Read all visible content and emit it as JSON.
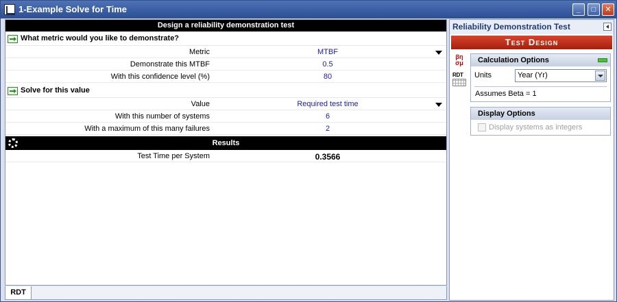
{
  "window": {
    "title": "1-Example Solve for Time",
    "minimize_label": "_",
    "maximize_label": "□",
    "close_label": "✕"
  },
  "main": {
    "header": "Design a reliability demonstration test",
    "section1": {
      "title": "What metric would you like to demonstrate?",
      "rows": [
        {
          "label": "Metric",
          "value": "MTBF"
        },
        {
          "label": "Demonstrate this MTBF",
          "value": "0.5"
        },
        {
          "label": "With this confidence level (%)",
          "value": "80"
        }
      ]
    },
    "section2": {
      "title": "Solve for this value",
      "rows": [
        {
          "label": "Value",
          "value": "Required test time"
        },
        {
          "label": "With this number of systems",
          "value": "6"
        },
        {
          "label": "With a maximum of this many failures",
          "value": "2"
        }
      ]
    },
    "results": {
      "title": "Results",
      "rows": [
        {
          "label": "Test Time per System",
          "value": "0.3566"
        }
      ]
    }
  },
  "tabs": [
    {
      "label": "RDT"
    }
  ],
  "side": {
    "title": "Reliability Demonstration Test",
    "banner": "Test Design",
    "greek_icon": "βη σμ",
    "rdt_icon_label": "RDT",
    "calc_options": {
      "title": "Calculation Options",
      "units_label": "Units",
      "units_value": "Year (Yr)",
      "note": "Assumes Beta = 1"
    },
    "display_options": {
      "title": "Display Options",
      "checkbox_label": "Display systems as integers",
      "checked": false
    }
  },
  "colors": {
    "title_bar": "#2d4f93",
    "value_text": "#1a1aa8",
    "banner": "#c0321b",
    "header_black": "#000000"
  }
}
